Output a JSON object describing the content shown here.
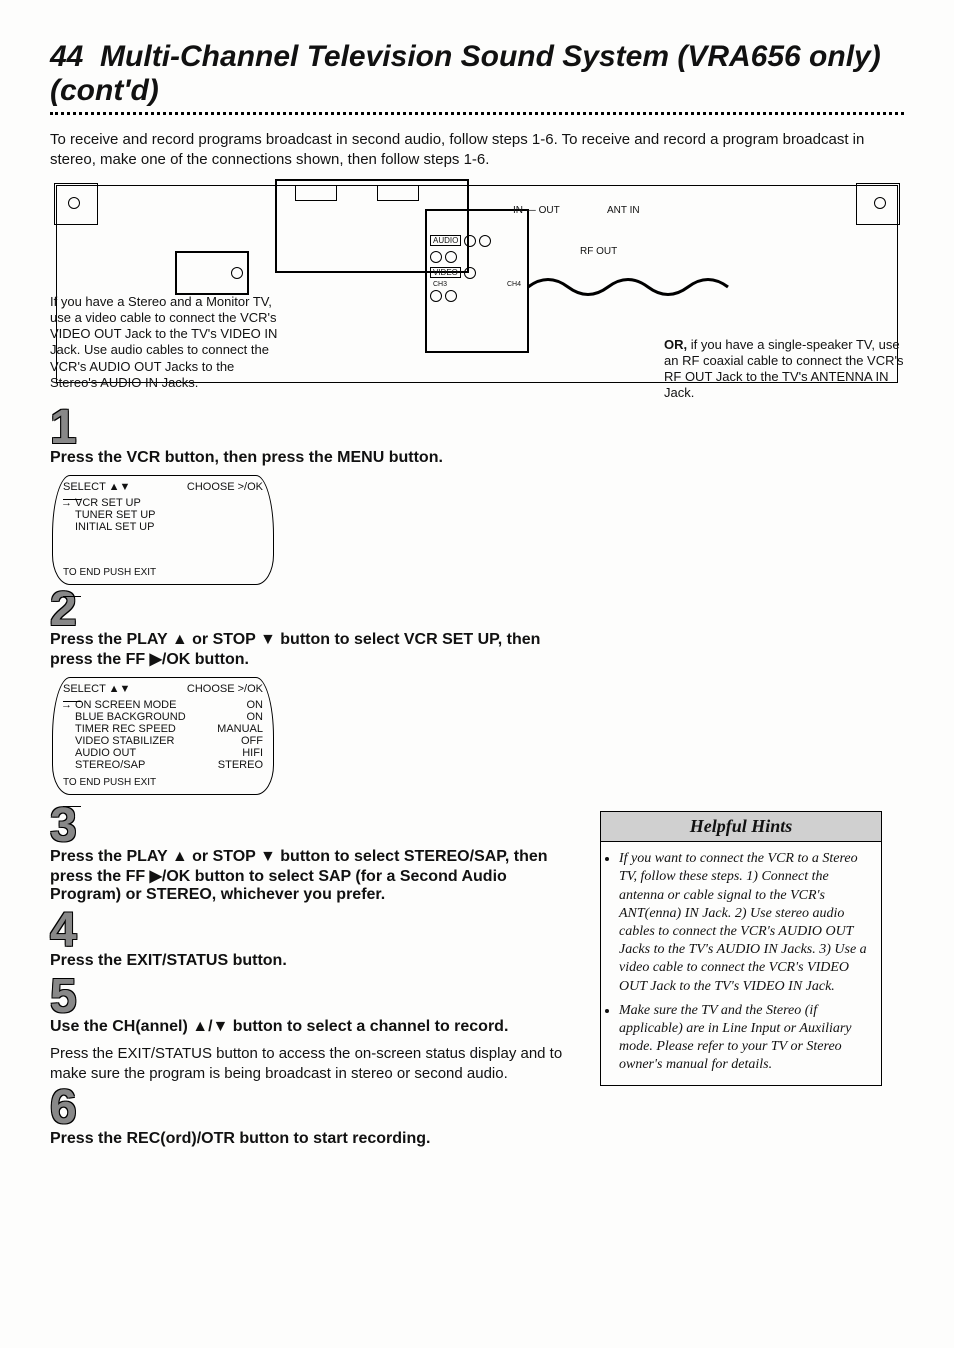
{
  "header": {
    "page_num": "44",
    "title": "Multi-Channel Television Sound System (VRA656 only) (cont'd)"
  },
  "intro": "To receive and record programs broadcast in second audio, follow steps 1-6. To receive and record a program broadcast in stereo, make one of the connections shown, then follow steps 1-6.",
  "diagram": {
    "left_callout": "If you have a Stereo and a Monitor TV, use a video cable to connect the VCR's VIDEO OUT Jack to the TV's VIDEO IN Jack. Use audio cables to connect the VCR's AUDIO OUT Jacks to the Stereo's AUDIO IN Jacks.",
    "right_callout_strong": "OR,",
    "right_callout": " if you have a single-speaker TV, use an RF coaxial cable to connect the VCR's RF OUT Jack to the TV's ANTENNA IN Jack.",
    "labels": {
      "audio": "AUDIO",
      "video": "VIDEO",
      "ch3": "CH3",
      "ch4": "CH4",
      "in": "IN",
      "out": "OUT",
      "ant_in": "ANT IN",
      "rf_out": "RF OUT"
    }
  },
  "steps": {
    "s1": {
      "num": "1",
      "head": "Press the VCR button, then press the MENU button.",
      "osd_header_l": "SELECT ▲▼",
      "osd_header_r": "CHOOSE >/OK",
      "items": [
        "VCR SET UP",
        "TUNER SET UP",
        "INITIAL SET UP"
      ],
      "footer": "TO END PUSH EXIT"
    },
    "s2": {
      "num": "2",
      "head": "Press the PLAY ▲ or STOP ▼ button to select VCR SET UP, then press the FF ▶/OK button.",
      "osd_header_l": "SELECT ▲▼",
      "osd_header_r": "CHOOSE >/OK",
      "rows": [
        {
          "l": "ON SCREEN MODE",
          "r": "ON"
        },
        {
          "l": "BLUE BACKGROUND",
          "r": "ON"
        },
        {
          "l": "TIMER REC SPEED",
          "r": "MANUAL"
        },
        {
          "l": "VIDEO STABILIZER",
          "r": "OFF"
        },
        {
          "l": "AUDIO OUT",
          "r": "HIFI"
        },
        {
          "l": "STEREO/SAP",
          "r": "STEREO"
        }
      ],
      "footer": "TO END PUSH EXIT"
    },
    "s3": {
      "num": "3",
      "head": "Press the PLAY ▲ or STOP ▼ button to select STEREO/SAP, then press the FF ▶/OK button to select SAP (for a Second Audio Program) or STEREO, whichever you prefer."
    },
    "s4": {
      "num": "4",
      "head": "Press the EXIT/STATUS button."
    },
    "s5": {
      "num": "5",
      "head": "Use the CH(annel) ▲/▼ button to select a channel to record.",
      "body": "Press the EXIT/STATUS button to access the on-screen status display and to make sure the program is being broadcast in stereo or second audio."
    },
    "s6": {
      "num": "6",
      "head": "Press the REC(ord)/OTR button to start recording."
    }
  },
  "hints": {
    "title": "Helpful Hints",
    "items": [
      "If you want to connect the VCR to a Stereo TV, follow these steps. 1) Connect the antenna or cable signal to the VCR's ANT(enna) IN Jack. 2) Use stereo audio cables to connect the VCR's AUDIO OUT Jacks to the TV's AUDIO IN Jacks. 3) Use a video cable to connect the VCR's VIDEO OUT Jack to the TV's VIDEO IN Jack.",
      "Make sure the TV and the Stereo (if applicable) are in Line Input or Auxiliary mode. Please refer to your TV or Stereo owner's manual for details."
    ]
  }
}
